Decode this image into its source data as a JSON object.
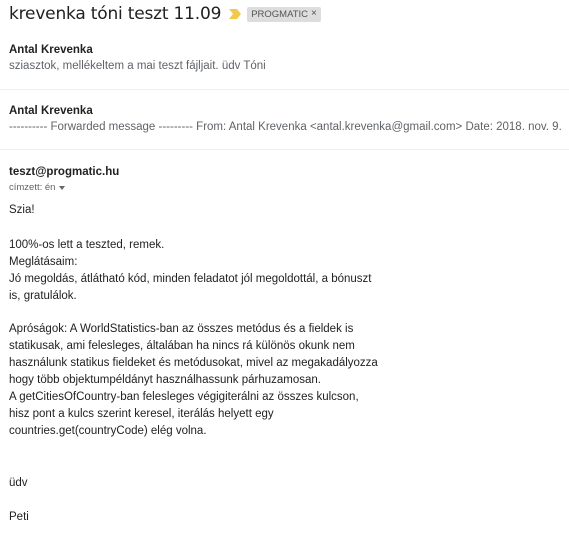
{
  "thread": {
    "subject": "krevenka tóni teszt 11.09",
    "label": "PROGMATIC",
    "label_close": "×",
    "important_color": "#f2c94c"
  },
  "messages": [
    {
      "sender": "Antal Krevenka",
      "snippet": "sziasztok, mellékeltem a mai teszt fájljait. üdv Tóni"
    },
    {
      "sender": "Antal Krevenka",
      "snippet": "---------- Forwarded message --------- From: Antal Krevenka <antal.krevenka@gmail.com> Date: 2018. nov. 9."
    },
    {
      "sender": "teszt@progmatic.hu",
      "to": "címzett: én",
      "body": [
        "Szia!",
        "100%-os lett a teszted, remek.",
        "Meglátásaim:",
        "Jó megoldás, átlátható kód, minden feladatot jól megoldottál, a bónuszt",
        "is, gratulálok.",
        "Apróságok: A WorldStatistics-ban az összes metódus és a fieldek is",
        "statikusak, ami felesleges, általában ha nincs rá különös okunk nem",
        "használunk statikus fieldeket és metódusokat, mivel az megakadályozza",
        "hogy több objektumpéldányt használhassunk párhuzamosan.",
        "A getCitiesOfCountry-ban felesleges végigiterálni az összes kulcson,",
        "hisz pont a kulcs szerint keresel, iterálás helyett egy",
        "countries.get(countryCode) elég volna.",
        "üdv",
        "Peti"
      ]
    }
  ]
}
